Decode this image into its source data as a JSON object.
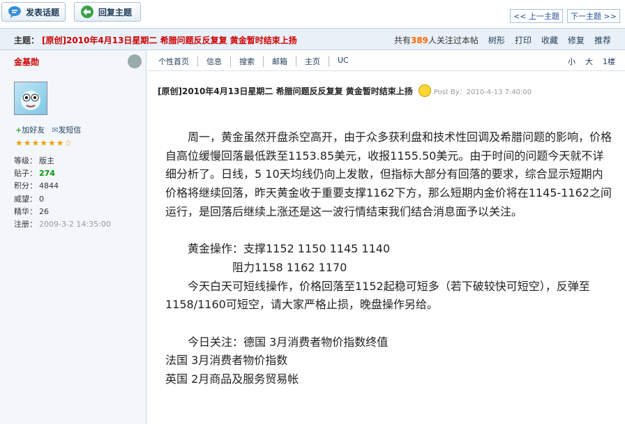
{
  "toolbar": {
    "post_topic_label": "发表话题",
    "reply_topic_label": "回复主题",
    "prev_topic_label": "<< 上一主题",
    "next_topic_label": "下一主题 >>"
  },
  "subject": {
    "label": "主题：",
    "title": "[原创]2010年4月13日星期二  希腊问题反反复复  黄金暂时结束上扬",
    "followers_prefix": "共有",
    "followers_count": "389",
    "followers_suffix": "人关注过本帖",
    "actions": [
      "树形",
      "打印",
      "收藏",
      "修复",
      "推荐"
    ]
  },
  "user": {
    "name": "金基勋",
    "add_friend": "加好友",
    "send_message": "发短信",
    "stars": "★★★★★★☆",
    "stats": [
      {
        "key": "等级：",
        "value": "版主"
      },
      {
        "key": "贴子：",
        "value": "274"
      },
      {
        "key": "积分：",
        "value": "4844"
      },
      {
        "key": "威望：",
        "value": "0"
      },
      {
        "key": "精华：",
        "value": "26"
      },
      {
        "key": "注册：",
        "value": "2009-3-2 14:35:00"
      }
    ]
  },
  "post": {
    "links": [
      "个性首页",
      "信息",
      "搜索",
      "邮箱",
      "主页",
      "UC"
    ],
    "font_small": "小",
    "font_large": "大",
    "floor": "1楼",
    "title": "[原创]2010年4月13日星期二  希腊问题反反复复  黄金暂时结束上扬",
    "post_by": "Post By：2010-4-13 7:40:00",
    "paragraphs": [
      "　　周一，黄金虽然开盘杀空高开，由于众多获利盘和技术性回调及希腊问题的影响，价格自高位缓慢回落最低跌至1153.85美元，收报1155.50美元。由于时间的问题今天就不详细分析了。日线，5 10天均线仍向上发散，但指标大部分有回落的要求，综合显示短期内价格将继续回落，昨天黄金收于重要支撑1162下方，那么短期内金价将在1145-1162之间运行，是回落后继续上涨还是这一波行情结束我们结合消息面予以关注。",
      "",
      "　　黄金操作：支撑1152 1150 1145 1140",
      "　　　　　　阻力1158 1162 1170",
      "　　今天白天可短线操作，价格回落至1152起稳可短多（若下破较快可短空），反弹至1158/1160可短空，请大家严格止损，晚盘操作另给。",
      "",
      "　　今日关注：德国 3月消费者物价指数终值",
      "法国 3月消费者物价指数",
      "英国 2月商品及服务贸易帐"
    ]
  }
}
